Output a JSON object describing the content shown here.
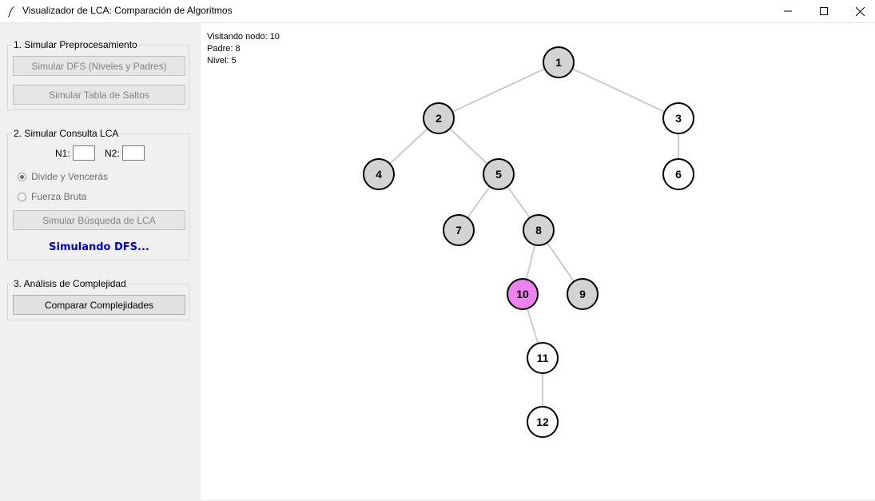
{
  "window": {
    "title": "Visualizador de LCA: Comparación de Algoritmos",
    "icon": "feather-icon",
    "controls": [
      "minimize-icon",
      "maximize-icon",
      "close-icon"
    ]
  },
  "sidebar": {
    "preprocessing": {
      "title": "1. Simular Preprocesamiento",
      "dfs_button": "Simular DFS (Niveles y Padres)",
      "jump_table_button": "Simular Tabla de Saltos"
    },
    "query": {
      "title": "2. Simular Consulta LCA",
      "n1_label": "N1:",
      "n1_value": "",
      "n2_label": "N2:",
      "n2_value": "",
      "options": [
        {
          "label": "Divide y Vencerás",
          "checked": true
        },
        {
          "label": "Fuerza Bruta",
          "checked": false
        }
      ],
      "search_button": "Simular Búsqueda de LCA",
      "status": "Simulando DFS..."
    },
    "complexity": {
      "title": "3. Análisis de Complejidad",
      "compare_button": "Comparar Complejidades"
    }
  },
  "canvas": {
    "info_lines": [
      "Visitando nodo: 10",
      "Padre: 8",
      "Nivel: 5"
    ],
    "colors": {
      "visited": "#d3d3d3",
      "current": "#ee82ee",
      "unvisited": "#ffffff",
      "edge": "#cccccc",
      "status_text": "#0000cd"
    },
    "tree": {
      "nodes": [
        {
          "id": "1",
          "state": "visited"
        },
        {
          "id": "2",
          "state": "visited"
        },
        {
          "id": "3",
          "state": "unvisited"
        },
        {
          "id": "4",
          "state": "visited"
        },
        {
          "id": "5",
          "state": "visited"
        },
        {
          "id": "6",
          "state": "unvisited"
        },
        {
          "id": "7",
          "state": "visited"
        },
        {
          "id": "8",
          "state": "visited"
        },
        {
          "id": "9",
          "state": "visited"
        },
        {
          "id": "10",
          "state": "current"
        },
        {
          "id": "11",
          "state": "unvisited"
        },
        {
          "id": "12",
          "state": "unvisited"
        }
      ],
      "edges": [
        [
          "1",
          "2"
        ],
        [
          "1",
          "3"
        ],
        [
          "2",
          "4"
        ],
        [
          "2",
          "5"
        ],
        [
          "3",
          "6"
        ],
        [
          "5",
          "7"
        ],
        [
          "5",
          "8"
        ],
        [
          "8",
          "10"
        ],
        [
          "8",
          "9"
        ],
        [
          "10",
          "11"
        ],
        [
          "11",
          "12"
        ]
      ]
    }
  }
}
